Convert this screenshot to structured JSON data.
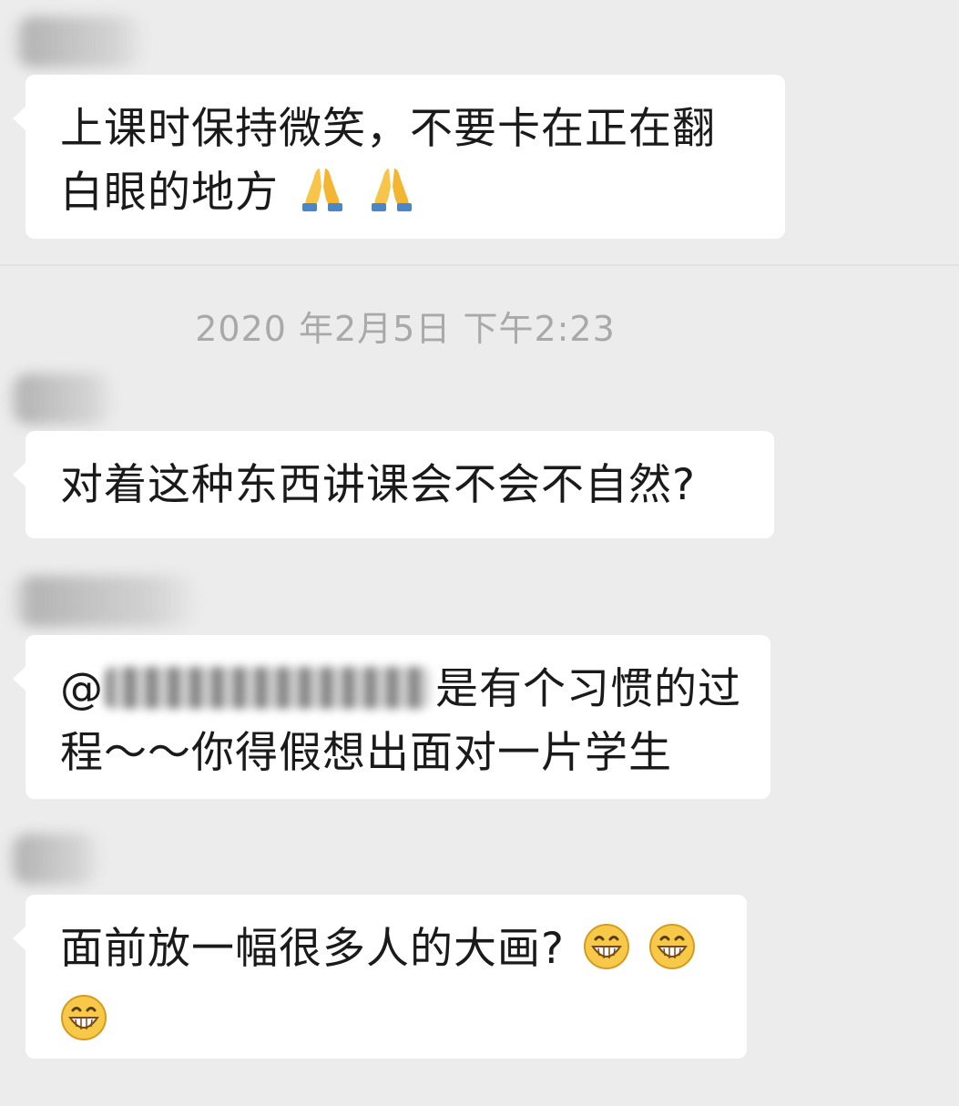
{
  "chat": {
    "messages": [
      {
        "lines": [
          "上课时保持微笑，不要卡在正在翻",
          "白眼的地方"
        ],
        "emojis": [
          "folded-hands-icon",
          "folded-hands-icon"
        ]
      },
      {
        "lines": [
          "对着这种东西讲课会不会不自然?"
        ]
      },
      {
        "mention_prefix": "@",
        "line1_after_mention": "是有个习惯的过",
        "line2": "程～～你得假想出面对一片学生"
      },
      {
        "lines": [
          "面前放一幅很多人的大画?"
        ],
        "emojis": [
          "grinning-face-icon",
          "grinning-face-icon",
          "grinning-face-icon"
        ]
      }
    ],
    "timestamp": "2020 年2月5日 下午2:23"
  },
  "colors": {
    "background": "#ececec",
    "bubble": "#ffffff",
    "text": "#1a1a1a",
    "timestamp": "#a9a9a9"
  }
}
